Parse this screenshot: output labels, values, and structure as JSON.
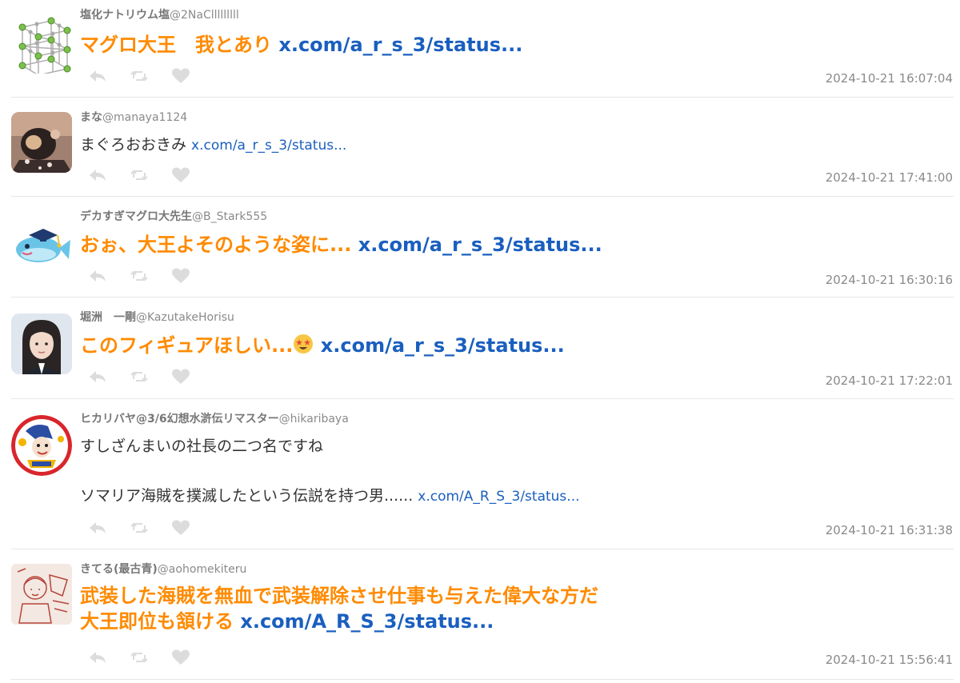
{
  "tweets": [
    {
      "name": "塩化ナトリウム塩",
      "handle": "@2NaClllllllll",
      "text": "マグロ大王　我とあり ",
      "link": "x.com/a_r_s_3/status...",
      "timestamp": "2024-10-21 16:07:04",
      "avatar": "sodium-chloride-lattice-avatar"
    },
    {
      "name": "まな",
      "handle": "@manaya1124",
      "text": "まぐろおおきみ ",
      "link": "x.com/a_r_s_3/status...",
      "timestamp": "2024-10-21 17:41:00",
      "avatar": "photo-avatar"
    },
    {
      "name": "デカすぎマグロ大先生",
      "handle": "@B_Stark555",
      "text": "おぉ、大王よそのような姿に... ",
      "link": "x.com/a_r_s_3/status...",
      "timestamp": "2024-10-21 16:30:16",
      "avatar": "tuna-graduate-avatar"
    },
    {
      "name": "堀洲　一剛",
      "handle": "@KazutakeHorisu",
      "text": "このフィギュアほしい...",
      "emoji": "star-struck-emoji",
      "link": "x.com/a_r_s_3/status...",
      "timestamp": "2024-10-21 17:22:01",
      "avatar": "portrait-avatar"
    },
    {
      "name": "ヒカリバヤ@3/6幻想水滸伝リマスター",
      "handle": "@hikaribaya",
      "text_line1": "すしざんまいの社長の二つ名ですね",
      "text_line2": "ソマリア海賊を撲滅したという伝説を持つ男...... ",
      "link": "x.com/A_R_S_3/status...",
      "timestamp": "2024-10-21 16:31:38",
      "avatar": "cartoon-character-avatar"
    },
    {
      "name": "きてる(最古青)",
      "handle": "@aohomekiteru",
      "text_line1": "武装した海賊を無血で武装解除させ仕事も与えた偉大な方だ",
      "text_line2": "大王即位も頷ける ",
      "link": "x.com/A_R_S_3/status...",
      "timestamp": "2024-10-21 15:56:41",
      "avatar": "sketch-avatar"
    }
  ],
  "colors": {
    "accent_text": "#ff8a00",
    "link": "#1a5fbf",
    "muted": "#8a8a8a",
    "action_icon": "#dcdcdc"
  },
  "icons": [
    "reply-icon",
    "retweet-icon",
    "like-icon"
  ]
}
